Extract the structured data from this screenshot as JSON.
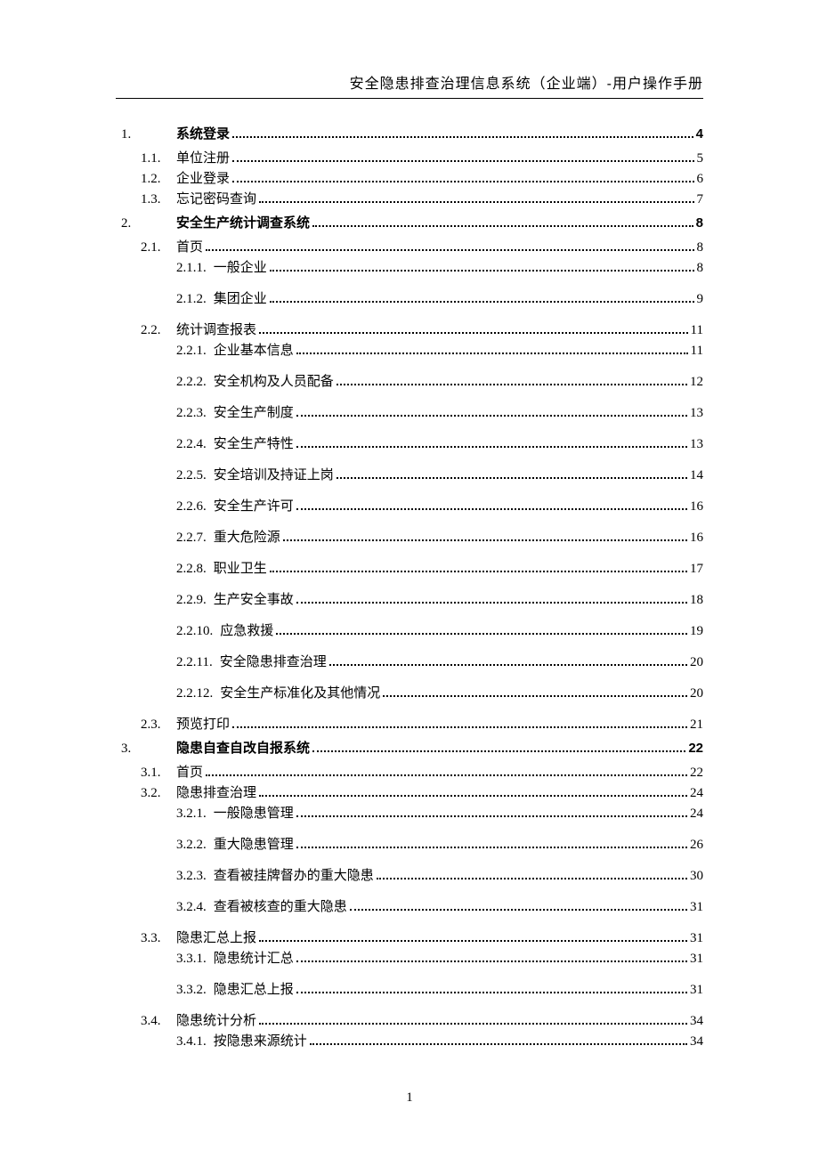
{
  "header": "安全隐患排查治理信息系统（企业端）-用户操作手册",
  "page_number": "1",
  "toc": [
    {
      "level": 1,
      "num": "1.",
      "label": "系统登录",
      "page": "4",
      "bold": true
    },
    {
      "level": 2,
      "num": "1.1.",
      "label": "单位注册",
      "page": "5"
    },
    {
      "level": 2,
      "num": "1.2.",
      "label": "企业登录",
      "page": "6"
    },
    {
      "level": 2,
      "num": "1.3.",
      "label": "忘记密码查询",
      "page": "7"
    },
    {
      "level": 1,
      "num": "2.",
      "label": "安全生产统计调查系统",
      "page": "8",
      "bold": true
    },
    {
      "level": 2,
      "num": "2.1.",
      "label": "首页",
      "page": "8"
    },
    {
      "level": 3,
      "num": "2.1.1.",
      "label": "一般企业",
      "page": "8",
      "gap_after": true
    },
    {
      "level": 3,
      "num": "2.1.2.",
      "label": "集团企业",
      "page": "9",
      "gap_after": true
    },
    {
      "level": 2,
      "num": "2.2.",
      "label": "统计调查报表",
      "page": "11"
    },
    {
      "level": 3,
      "num": "2.2.1.",
      "label": "企业基本信息",
      "page": "11",
      "gap_after": true
    },
    {
      "level": 3,
      "num": "2.2.2.",
      "label": "安全机构及人员配备",
      "page": "12",
      "gap_after": true
    },
    {
      "level": 3,
      "num": "2.2.3.",
      "label": "安全生产制度",
      "page": "13",
      "gap_after": true
    },
    {
      "level": 3,
      "num": "2.2.4.",
      "label": "安全生产特性",
      "page": "13",
      "gap_after": true
    },
    {
      "level": 3,
      "num": "2.2.5.",
      "label": "安全培训及持证上岗",
      "page": "14",
      "gap_after": true
    },
    {
      "level": 3,
      "num": "2.2.6.",
      "label": "安全生产许可",
      "page": "16",
      "gap_after": true
    },
    {
      "level": 3,
      "num": "2.2.7.",
      "label": "重大危险源",
      "page": "16",
      "gap_after": true
    },
    {
      "level": 3,
      "num": "2.2.8.",
      "label": "职业卫生",
      "page": "17",
      "gap_after": true
    },
    {
      "level": 3,
      "num": "2.2.9.",
      "label": "生产安全事故",
      "page": "18",
      "gap_after": true
    },
    {
      "level": 3,
      "num": "2.2.10.",
      "label": "应急救援",
      "page": "19",
      "gap_after": true
    },
    {
      "level": 3,
      "num": "2.2.11.",
      "label": "安全隐患排查治理",
      "page": "20",
      "gap_after": true
    },
    {
      "level": 3,
      "num": "2.2.12.",
      "label": "安全生产标准化及其他情况",
      "page": "20",
      "gap_after": true
    },
    {
      "level": 2,
      "num": "2.3.",
      "label": "预览打印",
      "page": "21"
    },
    {
      "level": 1,
      "num": "3.",
      "label": "隐患自查自改自报系统",
      "page": "22",
      "bold": true
    },
    {
      "level": 2,
      "num": "3.1.",
      "label": "首页",
      "page": "22"
    },
    {
      "level": 2,
      "num": "3.2.",
      "label": "隐患排查治理",
      "page": "24"
    },
    {
      "level": 3,
      "num": "3.2.1.",
      "label": "一般隐患管理",
      "page": "24",
      "gap_after": true
    },
    {
      "level": 3,
      "num": "3.2.2.",
      "label": "重大隐患管理",
      "page": "26",
      "gap_after": true
    },
    {
      "level": 3,
      "num": "3.2.3.",
      "label": "查看被挂牌督办的重大隐患",
      "page": "30",
      "gap_after": true
    },
    {
      "level": 3,
      "num": "3.2.4.",
      "label": "查看被核查的重大隐患",
      "page": "31",
      "gap_after": true
    },
    {
      "level": 2,
      "num": "3.3.",
      "label": "隐患汇总上报",
      "page": "31"
    },
    {
      "level": 3,
      "num": "3.3.1.",
      "label": "隐患统计汇总",
      "page": "31",
      "gap_after": true
    },
    {
      "level": 3,
      "num": "3.3.2.",
      "label": "隐患汇总上报",
      "page": "31",
      "gap_after": true
    },
    {
      "level": 2,
      "num": "3.4.",
      "label": "隐患统计分析",
      "page": "34"
    },
    {
      "level": 3,
      "num": "3.4.1.",
      "label": "按隐患来源统计",
      "page": "34"
    }
  ]
}
